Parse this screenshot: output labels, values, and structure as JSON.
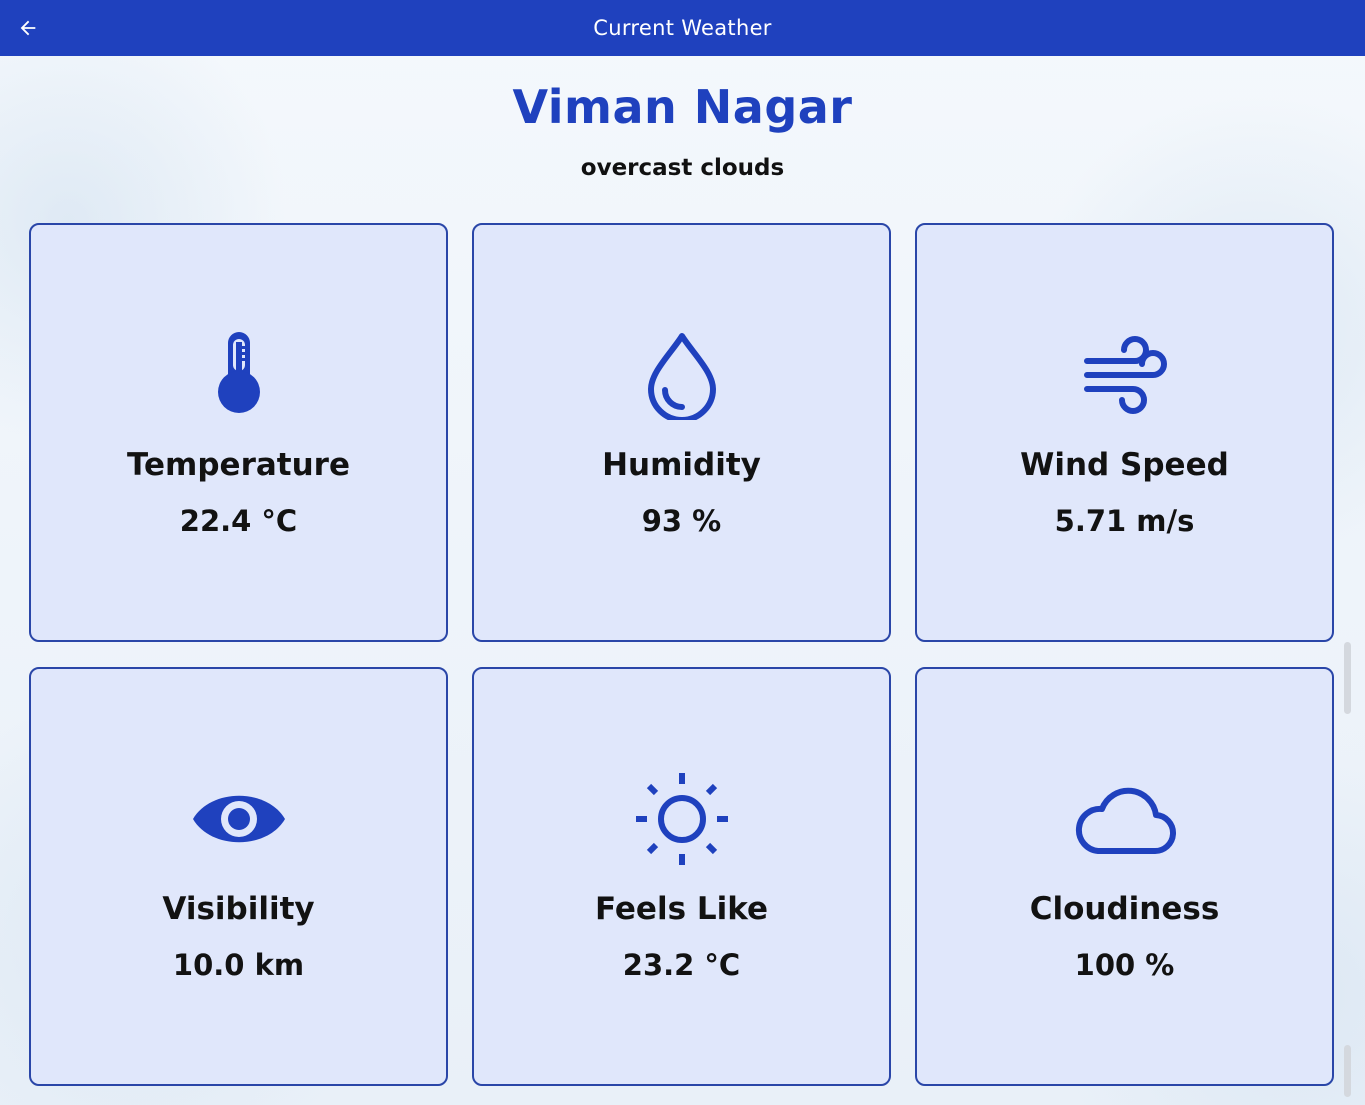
{
  "appbar": {
    "title": "Current Weather",
    "back_icon": "arrow-left-icon",
    "color": "#1f41be"
  },
  "location": {
    "city": "Viman Nagar",
    "condition": "overcast clouds"
  },
  "cards": [
    {
      "label": "Temperature",
      "value": "22.4 °C",
      "icon": "thermometer-icon"
    },
    {
      "label": "Humidity",
      "value": "93 %",
      "icon": "water-drop-icon"
    },
    {
      "label": "Wind Speed",
      "value": "5.71 m/s",
      "icon": "wind-icon"
    },
    {
      "label": "Visibility",
      "value": "10.0 km",
      "icon": "eye-icon"
    },
    {
      "label": "Feels Like",
      "value": "23.2 °C",
      "icon": "sun-icon"
    },
    {
      "label": "Cloudiness",
      "value": "100 %",
      "icon": "cloud-icon"
    }
  ],
  "colors": {
    "accent": "#1f41be",
    "card_background": "#e0e7fb",
    "card_border": "#2a46a8"
  }
}
